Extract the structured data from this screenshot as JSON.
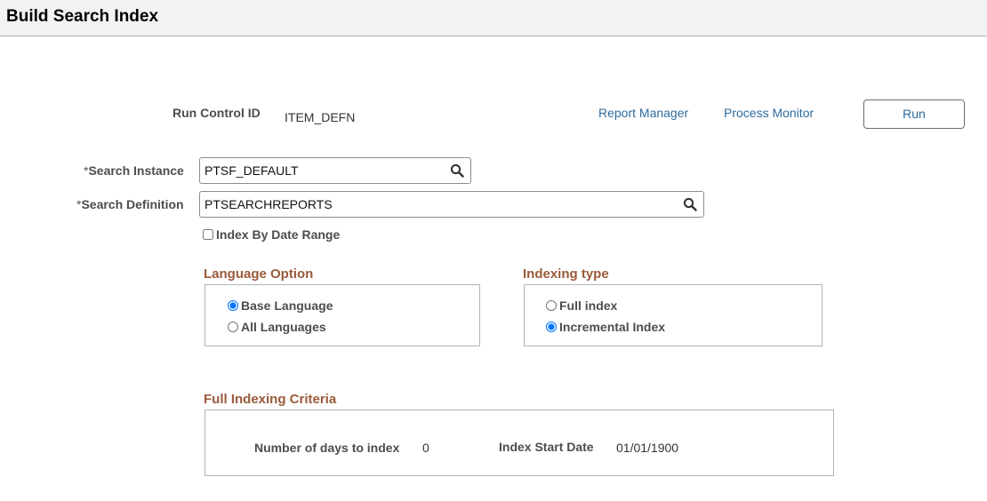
{
  "header": {
    "title": "Build Search Index"
  },
  "run_control": {
    "label": "Run Control ID",
    "value": "ITEM_DEFN",
    "report_manager": "Report Manager",
    "process_monitor": "Process Monitor",
    "run_button": "Run"
  },
  "search_instance": {
    "required_mark": "*",
    "label": "Search Instance",
    "value": "PTSF_DEFAULT",
    "lookup_icon": "search-icon"
  },
  "search_definition": {
    "required_mark": "*",
    "label": "Search Definition",
    "value": "PTSEARCHREPORTS",
    "lookup_icon": "search-icon"
  },
  "index_by_date_range": {
    "label": "Index By Date Range",
    "checked": false
  },
  "language_option": {
    "title": "Language Option",
    "options": [
      {
        "label": "Base Language",
        "selected": true
      },
      {
        "label": "All Languages",
        "selected": false
      }
    ]
  },
  "indexing_type": {
    "title": "Indexing type",
    "options": [
      {
        "label": "Full index",
        "selected": false
      },
      {
        "label": "Incremental Index",
        "selected": true
      }
    ]
  },
  "full_indexing_criteria": {
    "title": "Full Indexing Criteria",
    "days_label": "Number of days to index",
    "days_value": "0",
    "start_date_label": "Index Start Date",
    "start_date_value": "01/01/1900"
  },
  "colors": {
    "link": "#2e6b9e",
    "section_title": "#9b5a3a",
    "titlebar_bg": "#f2f2f2"
  }
}
